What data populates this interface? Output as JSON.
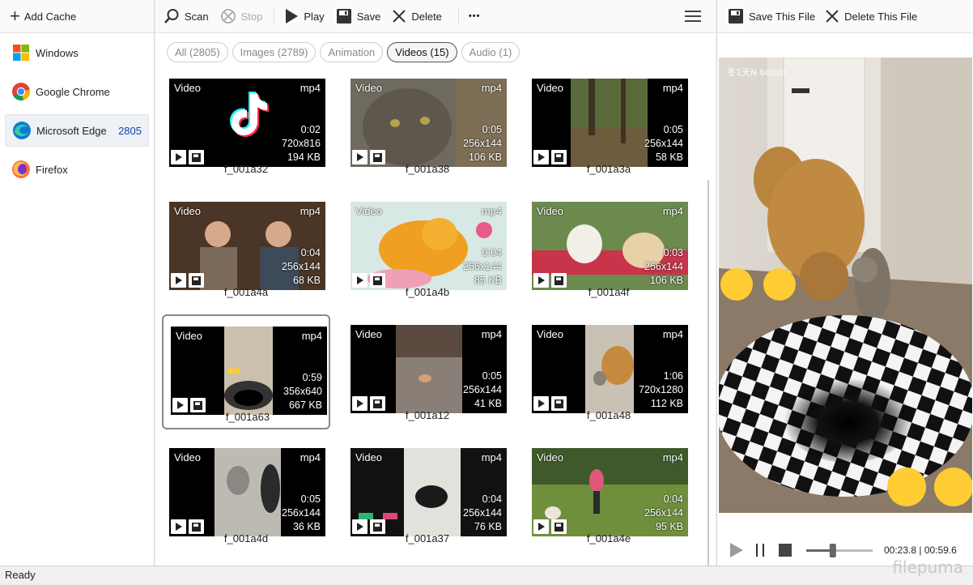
{
  "sidebar": {
    "add_cache_label": "Add Cache",
    "browsers": [
      {
        "name": "Windows",
        "icon": "windows-icon",
        "count": ""
      },
      {
        "name": "Google Chrome",
        "icon": "chrome-icon",
        "count": ""
      },
      {
        "name": "Microsoft Edge",
        "icon": "edge-icon",
        "count": "2805"
      },
      {
        "name": "Firefox",
        "icon": "firefox-icon",
        "count": ""
      }
    ]
  },
  "toolbar": {
    "scan": "Scan",
    "stop": "Stop",
    "play": "Play",
    "save": "Save",
    "delete": "Delete",
    "more": "•••"
  },
  "filters": [
    {
      "label": "All (2805)",
      "active": false
    },
    {
      "label": "Images (2789)",
      "active": false
    },
    {
      "label": "Animation",
      "active": false
    },
    {
      "label": "Videos (15)",
      "active": true
    },
    {
      "label": "Audio (1)",
      "active": false
    }
  ],
  "media": [
    {
      "name": "f_001a32",
      "type": "Video",
      "ext": "mp4",
      "duration": "0:02",
      "res": "720x816",
      "size": "194 KB",
      "theme": "tiktok"
    },
    {
      "name": "f_001a38",
      "type": "Video",
      "ext": "mp4",
      "duration": "0:05",
      "res": "256x144",
      "size": "106 KB",
      "theme": "cat"
    },
    {
      "name": "f_001a3a",
      "type": "Video",
      "ext": "mp4",
      "duration": "0:05",
      "res": "256x144",
      "size": "58 KB",
      "theme": "forest"
    },
    {
      "name": "f_001a4a",
      "type": "Video",
      "ext": "mp4",
      "duration": "0:04",
      "res": "256x144",
      "size": "68 KB",
      "theme": "studio"
    },
    {
      "name": "f_001a4b",
      "type": "Video",
      "ext": "mp4",
      "duration": "0:04",
      "res": "256x144",
      "size": "85 KB",
      "theme": "cartoon"
    },
    {
      "name": "f_001a4f",
      "type": "Video",
      "ext": "mp4",
      "duration": "0:03",
      "res": "256x144",
      "size": "106 KB",
      "theme": "dogs"
    },
    {
      "name": "f_001a63",
      "type": "Video",
      "ext": "mp4",
      "duration": "0:59",
      "res": "356x640",
      "size": "667 KB",
      "theme": "hole",
      "selected": true
    },
    {
      "name": "f_001a12",
      "type": "Video",
      "ext": "mp4",
      "duration": "0:05",
      "res": "256x144",
      "size": "41 KB",
      "theme": "floor"
    },
    {
      "name": "f_001a48",
      "type": "Video",
      "ext": "mp4",
      "duration": "1:06",
      "res": "720x1280",
      "size": "112 KB",
      "theme": "goldendog"
    },
    {
      "name": "f_001a4d",
      "type": "Video",
      "ext": "mp4",
      "duration": "0:05",
      "res": "256x144",
      "size": "36 KB",
      "theme": "greycat"
    },
    {
      "name": "f_001a37",
      "type": "Video",
      "ext": "mp4",
      "duration": "0:04",
      "res": "256x144",
      "size": "76 KB",
      "theme": "blackcat"
    },
    {
      "name": "f_001a4e",
      "type": "Video",
      "ext": "mp4",
      "duration": "0:04",
      "res": "256x144",
      "size": "95 KB",
      "theme": "runner"
    }
  ],
  "preview": {
    "save_file": "Save This File",
    "delete_file": "Delete This File",
    "time": "00:23.8 | 00:59.6",
    "progress_fraction": 0.4,
    "overlay_text": "冬1天N bilibili"
  },
  "status": {
    "text": "Ready"
  },
  "watermark": "filepuma",
  "colors": {
    "accent": "#1a3fb0",
    "chip_active": "#555555"
  }
}
